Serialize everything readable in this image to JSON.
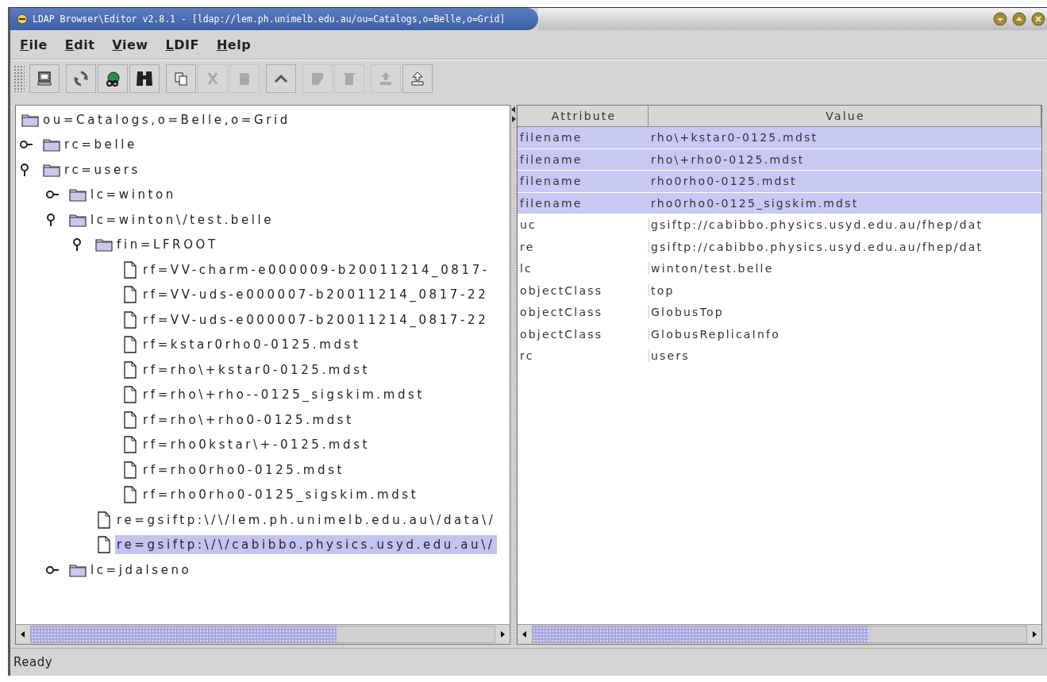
{
  "window": {
    "title": "LDAP Browser\\Editor v2.8.1 - [ldap://lem.ph.unimelb.edu.au/ou=Catalogs,o=Belle,o=Grid]"
  },
  "menu": [
    "File",
    "Edit",
    "View",
    "LDIF",
    "Help"
  ],
  "toolbar": [
    [
      {
        "disabled": false
      }
    ],
    [
      {
        "disabled": false
      },
      {
        "disabled": false
      },
      {
        "disabled": false
      }
    ],
    [
      {
        "disabled": false
      },
      {
        "disabled": true
      },
      {
        "disabled": true
      }
    ],
    [
      {
        "disabled": false
      }
    ],
    [
      {
        "disabled": true
      },
      {
        "disabled": true
      }
    ],
    [
      {
        "disabled": true
      },
      {
        "disabled": false
      }
    ]
  ],
  "tree": {
    "label": "ou=Catalogs,o=Belle,o=Grid",
    "kind": "folder",
    "selected": false,
    "children": [
      {
        "label": "rc=belle",
        "kind": "folder",
        "expanded": false,
        "selected": false
      },
      {
        "label": "rc=users",
        "kind": "folder",
        "expanded": true,
        "selected": false,
        "children": [
          {
            "label": "lc=winton",
            "kind": "folder",
            "expanded": false,
            "selected": false
          },
          {
            "label": "lc=winton\\/test.belle",
            "kind": "folder",
            "expanded": true,
            "selected": false,
            "children": [
              {
                "label": "fin=LFROOT",
                "kind": "folder",
                "expanded": true,
                "selected": false,
                "children": [
                  {
                    "label": "rf=VV-charm-e000009-b20011214_0817-",
                    "kind": "file",
                    "selected": false
                  },
                  {
                    "label": "rf=VV-uds-e000007-b20011214_0817-22",
                    "kind": "file",
                    "selected": false
                  },
                  {
                    "label": "rf=VV-uds-e000007-b20011214_0817-22",
                    "kind": "file",
                    "selected": false
                  },
                  {
                    "label": "rf=kstar0rho0-0125.mdst",
                    "kind": "file",
                    "selected": false
                  },
                  {
                    "label": "rf=rho\\+kstar0-0125.mdst",
                    "kind": "file",
                    "selected": false
                  },
                  {
                    "label": "rf=rho\\+rho--0125_sigskim.mdst",
                    "kind": "file",
                    "selected": false
                  },
                  {
                    "label": "rf=rho\\+rho0-0125.mdst",
                    "kind": "file",
                    "selected": false
                  },
                  {
                    "label": "rf=rho0kstar\\+-0125.mdst",
                    "kind": "file",
                    "selected": false
                  },
                  {
                    "label": "rf=rho0rho0-0125.mdst",
                    "kind": "file",
                    "selected": false
                  },
                  {
                    "label": "rf=rho0rho0-0125_sigskim.mdst",
                    "kind": "file",
                    "selected": false
                  }
                ]
              },
              {
                "label": "re=gsiftp:\\/\\/lem.ph.unimelb.edu.au\\/data\\/",
                "kind": "file",
                "selected": false
              },
              {
                "label": "re=gsiftp:\\/\\/cabibbo.physics.usyd.edu.au\\/",
                "kind": "file",
                "selected": true
              }
            ]
          },
          {
            "label": "lc=jdalseno",
            "kind": "folder",
            "expanded": false,
            "selected": false
          }
        ]
      }
    ]
  },
  "table": {
    "columns": [
      "Attribute",
      "Value"
    ],
    "rows": [
      {
        "attribute": "filename",
        "value": "rho\\+kstar0-0125.mdst",
        "selected": true
      },
      {
        "attribute": "filename",
        "value": "rho\\+rho0-0125.mdst",
        "selected": true
      },
      {
        "attribute": "filename",
        "value": "rho0rho0-0125.mdst",
        "selected": true
      },
      {
        "attribute": "filename",
        "value": "rho0rho0-0125_sigskim.mdst",
        "selected": true
      },
      {
        "attribute": "uc",
        "value": "gsiftp://cabibbo.physics.usyd.edu.au/fhep/dat",
        "selected": false
      },
      {
        "attribute": "re",
        "value": "gsiftp://cabibbo.physics.usyd.edu.au/fhep/dat",
        "selected": false
      },
      {
        "attribute": "lc",
        "value": "winton/test.belle",
        "selected": false
      },
      {
        "attribute": "objectClass",
        "value": "top",
        "selected": false
      },
      {
        "attribute": "objectClass",
        "value": "GlobusTop",
        "selected": false
      },
      {
        "attribute": "objectClass",
        "value": "GlobusReplicaInfo",
        "selected": false
      },
      {
        "attribute": "rc",
        "value": "users",
        "selected": false
      }
    ]
  },
  "status_bar": "Ready"
}
